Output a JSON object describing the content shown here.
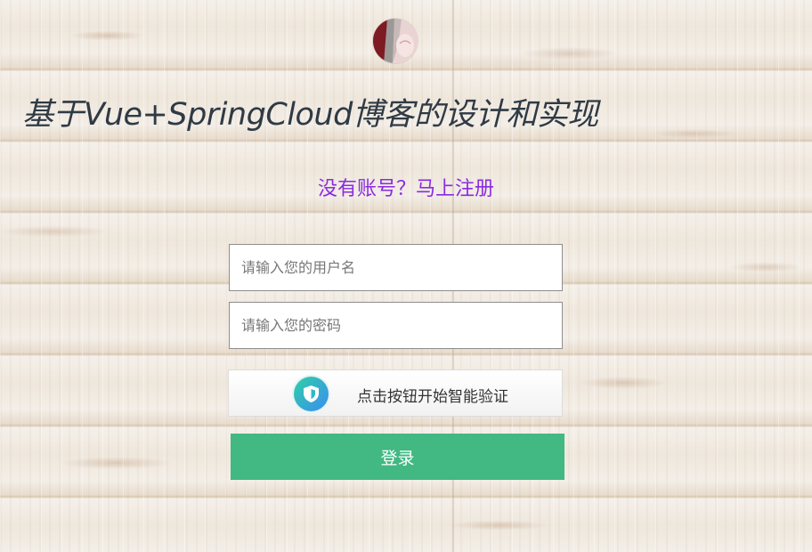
{
  "header": {
    "title": "基于Vue+SpringCloud博客的设计和实现",
    "avatar_icon": "user-avatar"
  },
  "register": {
    "link_text": "没有账号？马上注册",
    "color": "#8a2be2"
  },
  "form": {
    "username": {
      "placeholder": "请输入您的用户名",
      "value": ""
    },
    "password": {
      "placeholder": "请输入您的密码",
      "value": ""
    },
    "captcha": {
      "label": "点击按钮开始智能验证",
      "icon": "shield-icon"
    },
    "submit": {
      "label": "登录",
      "color": "#42b883"
    }
  }
}
